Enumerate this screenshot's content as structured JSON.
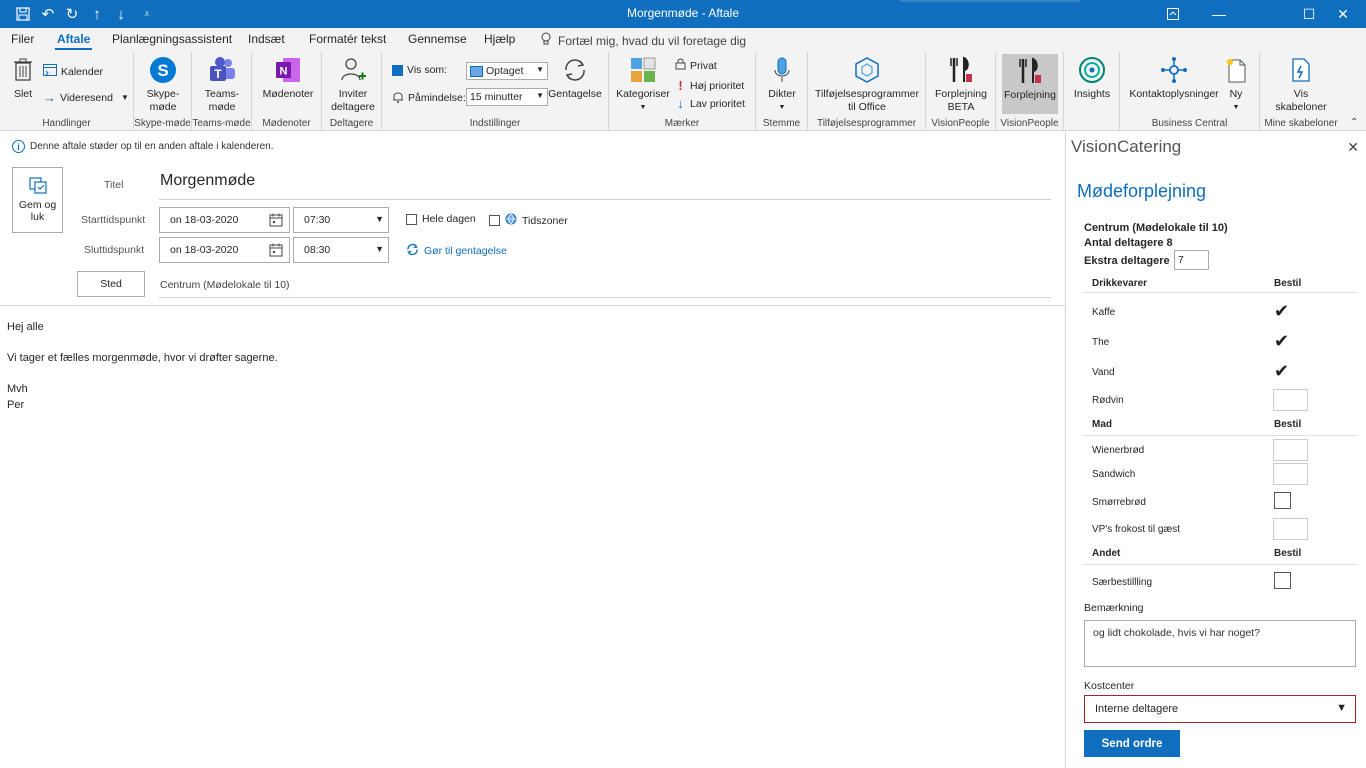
{
  "window": {
    "title": "Morgenmøde - Aftale"
  },
  "tabs": [
    {
      "label": "Filer"
    },
    {
      "label": "Aftale"
    },
    {
      "label": "Planlægningsassistent"
    },
    {
      "label": "Indsæt"
    },
    {
      "label": "Formatér tekst"
    },
    {
      "label": "Gennemse"
    },
    {
      "label": "Hjælp"
    }
  ],
  "tellme": "Fortæl mig, hvad du vil foretage dig",
  "ribbon": {
    "handlinger": {
      "delete": "Slet",
      "calendar": "Kalender",
      "forward": "Videresend",
      "group": "Handlinger"
    },
    "skype": {
      "label1": "Skype-",
      "label2": "møde",
      "group": "Skype-møde"
    },
    "teams": {
      "label1": "Teams-",
      "label2": "møde",
      "group": "Teams-møde"
    },
    "notes": {
      "label": "Mødenoter",
      "group": "Mødenoter"
    },
    "attendees": {
      "label1": "Inviter",
      "label2": "deltagere",
      "group": "Deltagere"
    },
    "options": {
      "show_as_label": "Vis som:",
      "show_as_value": "Optaget",
      "reminder_label": "Påmindelse:",
      "reminder_value": "15 minutter",
      "recurrence": "Gentagelse",
      "group": "Indstillinger"
    },
    "tags": {
      "categorize": "Kategoriser",
      "private": "Privat",
      "high": "Høj prioritet",
      "low": "Lav prioritet",
      "group": "Mærker"
    },
    "voice": {
      "label": "Dikter",
      "group": "Stemme"
    },
    "addins": {
      "label1": "Tilføjelsesprogrammer",
      "label2": "til Office",
      "group": "Tilføjelsesprogrammer"
    },
    "vp_beta": {
      "label1": "Forplejning",
      "label2": "BETA",
      "group": "VisionPeople"
    },
    "vp": {
      "label": "Forplejning",
      "group": "VisionPeople"
    },
    "insights": {
      "label": "Insights"
    },
    "contact": {
      "label": "Kontaktoplysninger"
    },
    "new": {
      "label": "Ny"
    },
    "bc": {
      "group": "Business Central"
    },
    "templates": {
      "label1": "Vis",
      "label2": "skabeloner",
      "group": "Mine skabeloner"
    }
  },
  "form": {
    "info": "Denne aftale støder op til en anden aftale i kalenderen.",
    "save_close_1": "Gem og",
    "save_close_2": "luk",
    "title_label": "Titel",
    "title_value": "Morgenmøde",
    "start_label": "Starttidspunkt",
    "start_date": "on 18-03-2020",
    "start_time": "07:30",
    "end_label": "Sluttidspunkt",
    "end_date": "on 18-03-2020",
    "end_time": "08:30",
    "all_day": "Hele dagen",
    "timezones": "Tidszoner",
    "make_recurring": "Gør til gentagelse",
    "location_button": "Sted",
    "location_value": "Centrum (Mødelokale til 10)"
  },
  "body": {
    "line1": "Hej alle",
    "line2": "Vi tager et fælles morgenmøde, hvor vi drøfter sagerne.",
    "line3": "Mvh",
    "line4": "Per"
  },
  "panel": {
    "title": "VisionCatering",
    "heading": "Mødeforplejning",
    "room": "Centrum (Mødelokale til 10)",
    "attendees": "Antal deltagere 8",
    "extra_label": "Ekstra deltagere",
    "extra_value": "7",
    "order_col": "Bestil",
    "drinks_head": "Drikkevarer",
    "drinks": [
      {
        "label": "Kaffe"
      },
      {
        "label": "The"
      },
      {
        "label": "Vand"
      },
      {
        "label": "Rødvin"
      }
    ],
    "food_head": "Mad",
    "food": [
      {
        "label": "Wienerbrød"
      },
      {
        "label": "Sandwich"
      },
      {
        "label": "Smørrebrød"
      },
      {
        "label": "VP's frokost til gæst"
      }
    ],
    "other_head": "Andet",
    "other": [
      {
        "label": "Særbestillling"
      }
    ],
    "remark_label": "Bemærkning",
    "remark_value": "og lidt chokolade, hvis vi har noget?",
    "cost_label": "Kostcenter",
    "cost_value": "Interne deltagere",
    "send": "Send ordre"
  }
}
